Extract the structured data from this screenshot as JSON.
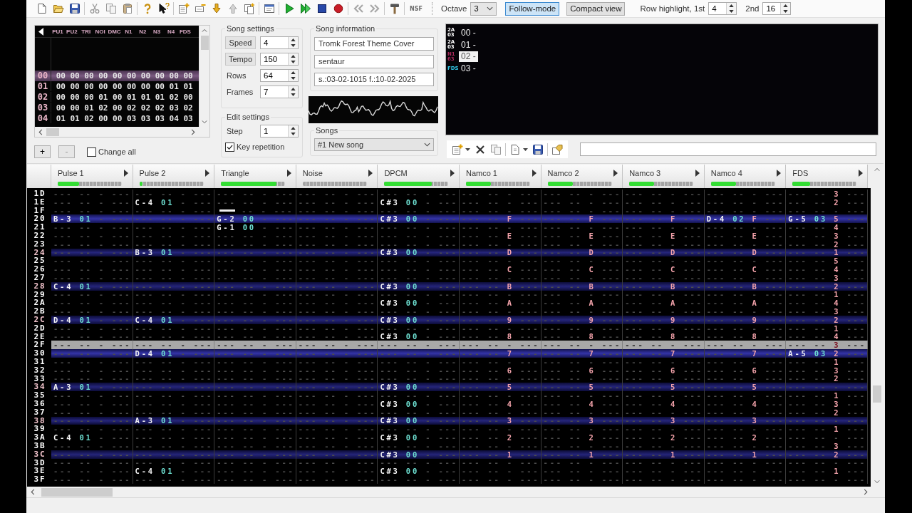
{
  "toolbar": {
    "export_label": "NSF",
    "octave": {
      "label": "Octave",
      "value": "3"
    },
    "follow_mode": {
      "label": "Follow-mode",
      "on": true
    },
    "compact_view": {
      "label": "Compact view",
      "on": false
    },
    "highlight_1st": {
      "label": "Row highlight, 1st",
      "value": "4"
    },
    "highlight_2nd": {
      "label": "2nd",
      "value": "16"
    }
  },
  "frames": {
    "columns": [
      "PU1",
      "PU2",
      "TRI",
      "NOI",
      "DMC",
      "N1",
      "N2",
      "N3",
      "N4",
      "FDS"
    ],
    "rows": [
      {
        "label": "00",
        "selected": true,
        "patterns": [
          "00",
          "00",
          "00",
          "00",
          "00",
          "00",
          "00",
          "00",
          "00",
          "00"
        ]
      },
      {
        "label": "01",
        "selected": false,
        "patterns": [
          "00",
          "00",
          "00",
          "00",
          "00",
          "00",
          "00",
          "00",
          "01",
          "01"
        ]
      },
      {
        "label": "02",
        "selected": false,
        "patterns": [
          "00",
          "00",
          "00",
          "01",
          "00",
          "01",
          "01",
          "01",
          "02",
          "00"
        ]
      },
      {
        "label": "03",
        "selected": false,
        "patterns": [
          "00",
          "00",
          "01",
          "02",
          "00",
          "02",
          "02",
          "02",
          "03",
          "02"
        ]
      },
      {
        "label": "04",
        "selected": false,
        "patterns": [
          "01",
          "01",
          "02",
          "00",
          "00",
          "03",
          "03",
          "03",
          "04",
          "03"
        ]
      }
    ]
  },
  "frame_controls": {
    "add": "+",
    "remove": "-",
    "change_all": {
      "label": "Change all",
      "checked": false
    }
  },
  "song_settings": {
    "title": "Song settings",
    "fields": [
      {
        "label": "Speed",
        "kind": "button",
        "value": "4"
      },
      {
        "label": "Tempo",
        "kind": "button",
        "value": "150"
      },
      {
        "label": "Rows",
        "kind": "label",
        "value": "64"
      },
      {
        "label": "Frames",
        "kind": "label",
        "value": "7"
      }
    ]
  },
  "edit_settings": {
    "title": "Edit settings",
    "step": {
      "label": "Step",
      "value": "1"
    },
    "key_repetition": {
      "label": "Key repetition",
      "checked": true
    }
  },
  "song_information": {
    "title": "Song information",
    "fields": [
      "Tromk Forest Theme Cover",
      "sentaur",
      "s.:03-02-1015 f.:10-02-2025"
    ]
  },
  "songs": {
    "title": "Songs",
    "value": "#1 New song"
  },
  "instruments": {
    "items": [
      {
        "chip": [
          "2A",
          "03"
        ],
        "color": "#ffffff",
        "label": "00 -",
        "selected": false
      },
      {
        "chip": [
          "2A",
          "03"
        ],
        "color": "#ffffff",
        "label": "01 -",
        "selected": false
      },
      {
        "chip": [
          "N1",
          "63"
        ],
        "color": "#a8285a",
        "label": "02 -",
        "selected": true
      },
      {
        "chip": [
          "FDS"
        ],
        "color": "#30c8e8",
        "label": "03 -",
        "selected": false
      }
    ]
  },
  "channels": [
    {
      "name": "Pulse 1",
      "level": 0.33
    },
    {
      "name": "Pulse 2",
      "level": 0.05
    },
    {
      "name": "Triangle",
      "level": 0.86
    },
    {
      "name": "Noise"
    },
    {
      "name": "DPCM",
      "level": 0.74
    },
    {
      "name": "Namco 1",
      "level": 0.39
    },
    {
      "name": "Namco 2",
      "level": 0.39
    },
    {
      "name": "Namco 3",
      "level": 0.39
    },
    {
      "name": "Namco 4",
      "level": 0.39
    },
    {
      "name": "FDS",
      "level": 0.27
    }
  ],
  "pattern": {
    "rows": [
      {
        "label": "1D",
        "kind": "normal",
        "cells": [
          "--- -- - ---",
          "--- -- - ---",
          "--- -- - ---",
          "--- -- - ---",
          "--- -- - ---",
          "--- -- - ---",
          "--- -- - ---",
          "--- -- - ---",
          "--- -- - ---",
          "--- -- 3 ---"
        ]
      },
      {
        "label": "1E",
        "kind": "normal",
        "cells": [
          "--- -- - ---",
          "C-4 01 - ---",
          "--- -- - ---",
          "--- -- - ---",
          "C#3 00 - ---",
          "--- -- - ---",
          "--- -- - ---",
          "--- -- - ---",
          "--- -- - ---",
          "--- -- 2 ---"
        ]
      },
      {
        "label": "1F",
        "kind": "normal",
        "cells": [
          "--- -- - ---",
          "--- -- - ---",
          {
            "kind": "halt",
            "rest": "-- - ---"
          },
          "--- -- - ---",
          "--- -- - ---",
          "--- -- - ---",
          "--- -- - ---",
          "--- -- - ---",
          "--- -- - ---",
          "--- -- - ---"
        ]
      },
      {
        "label": "20",
        "kind": "measure",
        "cells": [
          "B-3 01 - ---",
          "--- -- - ---",
          "G-2 00 - ---",
          "--- -- - ---",
          "C#3 00 - ---",
          "--- -- F ---",
          "--- -- F ---",
          "--- -- F ---",
          "D-4 02 F ---",
          "G-5 03 5 ---"
        ]
      },
      {
        "label": "21",
        "kind": "normal",
        "cells": [
          "--- -- - ---",
          "--- -- - ---",
          "G-1 00 - ---",
          "--- -- - ---",
          "--- -- - ---",
          "--- -- - ---",
          "--- -- - ---",
          "--- -- - ---",
          "--- -- - ---",
          "--- -- 4 ---"
        ]
      },
      {
        "label": "22",
        "kind": "normal",
        "cells": [
          "--- -- - ---",
          "--- -- - ---",
          "--- -- - ---",
          "--- -- - ---",
          "--- -- - ---",
          "--- -- E ---",
          "--- -- E ---",
          "--- -- E ---",
          "--- -- E ---",
          "--- -- 3 ---"
        ]
      },
      {
        "label": "23",
        "kind": "normal",
        "cells": [
          "--- -- - ---",
          "--- -- - ---",
          "--- -- - ---",
          "--- -- - ---",
          "--- -- - ---",
          "--- -- - ---",
          "--- -- - ---",
          "--- -- - ---",
          "--- -- - ---",
          "--- -- 2 ---"
        ]
      },
      {
        "label": "24",
        "kind": "beat",
        "cells": [
          "--- -- - ---",
          "B-3 01 - ---",
          "--- -- - ---",
          "--- -- - ---",
          "C#3 00 - ---",
          "--- -- D ---",
          "--- -- D ---",
          "--- -- D ---",
          "--- -- D ---",
          "--- -- 1 ---"
        ]
      },
      {
        "label": "25",
        "kind": "normal",
        "cells": [
          "--- -- - ---",
          "--- -- - ---",
          "--- -- - ---",
          "--- -- - ---",
          "--- -- - ---",
          "--- -- - ---",
          "--- -- - ---",
          "--- -- - ---",
          "--- -- - ---",
          "--- -- 5 ---"
        ]
      },
      {
        "label": "26",
        "kind": "normal",
        "cells": [
          "--- -- - ---",
          "--- -- - ---",
          "--- -- - ---",
          "--- -- - ---",
          "--- -- - ---",
          "--- -- C ---",
          "--- -- C ---",
          "--- -- C ---",
          "--- -- C ---",
          "--- -- 4 ---"
        ]
      },
      {
        "label": "27",
        "kind": "normal",
        "cells": [
          "--- -- - ---",
          "--- -- - ---",
          "--- -- - ---",
          "--- -- - ---",
          "--- -- - ---",
          "--- -- - ---",
          "--- -- - ---",
          "--- -- - ---",
          "--- -- - ---",
          "--- -- 3 ---"
        ]
      },
      {
        "label": "28",
        "kind": "beat",
        "cells": [
          "C-4 01 - ---",
          "--- -- - ---",
          "--- -- - ---",
          "--- -- - ---",
          "C#3 00 - ---",
          "--- -- B ---",
          "--- -- B ---",
          "--- -- B ---",
          "--- -- B ---",
          "--- -- 2 ---"
        ]
      },
      {
        "label": "29",
        "kind": "normal",
        "cells": [
          "--- -- - ---",
          "--- -- - ---",
          "--- -- - ---",
          "--- -- - ---",
          "--- -- - ---",
          "--- -- - ---",
          "--- -- - ---",
          "--- -- - ---",
          "--- -- - ---",
          "--- -- 1 ---"
        ]
      },
      {
        "label": "2A",
        "kind": "normal",
        "cells": [
          "--- -- - ---",
          "--- -- - ---",
          "--- -- - ---",
          "--- -- - ---",
          "C#3 00 - ---",
          "--- -- A ---",
          "--- -- A ---",
          "--- -- A ---",
          "--- -- A ---",
          "--- -- 4 ---"
        ]
      },
      {
        "label": "2B",
        "kind": "normal",
        "cells": [
          "--- -- - ---",
          "--- -- - ---",
          "--- -- - ---",
          "--- -- - ---",
          "--- -- - ---",
          "--- -- - ---",
          "--- -- - ---",
          "--- -- - ---",
          "--- -- - ---",
          "--- -- 3 ---"
        ]
      },
      {
        "label": "2C",
        "kind": "beat",
        "cells": [
          "D-4 01 - ---",
          "C-4 01 - ---",
          "--- -- - ---",
          "--- -- - ---",
          "C#3 00 - ---",
          "--- -- 9 ---",
          "--- -- 9 ---",
          "--- -- 9 ---",
          "--- -- 9 ---",
          "--- -- 2 ---"
        ]
      },
      {
        "label": "2D",
        "kind": "normal",
        "cells": [
          "--- -- - ---",
          "--- -- - ---",
          "--- -- - ---",
          "--- -- - ---",
          "--- -- - ---",
          "--- -- - ---",
          "--- -- - ---",
          "--- -- - ---",
          "--- -- - ---",
          "--- -- 1 ---"
        ]
      },
      {
        "label": "2E",
        "kind": "normal",
        "cells": [
          "--- -- - ---",
          "--- -- - ---",
          "--- -- - ---",
          "--- -- - ---",
          "C#3 00 - ---",
          "--- -- 8 ---",
          "--- -- 8 ---",
          "--- -- 8 ---",
          "--- -- 8 ---",
          "--- -- 4 ---"
        ]
      },
      {
        "label": "2F",
        "kind": "cursor",
        "cells": [
          "--- -- - ---",
          "--- -- - ---",
          "--- -- - ---",
          "--- -- - ---",
          "--- -- - ---",
          "--- -- - ---",
          "--- -- - ---",
          "--- -- - ---",
          "--- -- - ---",
          "--- -- 3 ---"
        ]
      },
      {
        "label": "30",
        "kind": "measure",
        "cells": [
          "--- -- - ---",
          "D-4 01 - ---",
          "--- -- - ---",
          "--- -- - ---",
          "--- -- - ---",
          "--- -- 7 ---",
          "--- -- 7 ---",
          "--- -- 7 ---",
          "--- -- 7 ---",
          "A-5 03 2 ---"
        ]
      },
      {
        "label": "31",
        "kind": "normal",
        "cells": [
          "--- -- - ---",
          "--- -- - ---",
          "--- -- - ---",
          "--- -- - ---",
          "--- -- - ---",
          "--- -- - ---",
          "--- -- - ---",
          "--- -- - ---",
          "--- -- - ---",
          "--- -- 1 ---"
        ]
      },
      {
        "label": "32",
        "kind": "normal",
        "cells": [
          "--- -- - ---",
          "--- -- - ---",
          "--- -- - ---",
          "--- -- - ---",
          "--- -- - ---",
          "--- -- 6 ---",
          "--- -- 6 ---",
          "--- -- 6 ---",
          "--- -- 6 ---",
          "--- -- 3 ---"
        ]
      },
      {
        "label": "33",
        "kind": "normal",
        "cells": [
          "--- -- - ---",
          "--- -- - ---",
          "--- -- - ---",
          "--- -- - ---",
          "--- -- - ---",
          "--- -- - ---",
          "--- -- - ---",
          "--- -- - ---",
          "--- -- - ---",
          "--- -- 2 ---"
        ]
      },
      {
        "label": "34",
        "kind": "beat",
        "cells": [
          "A-3 01 - ---",
          "--- -- - ---",
          "--- -- - ---",
          "--- -- - ---",
          "C#3 00 - ---",
          "--- -- 5 ---",
          "--- -- 5 ---",
          "--- -- 5 ---",
          "--- -- 5 ---",
          "--- -- - ---"
        ]
      },
      {
        "label": "35",
        "kind": "normal",
        "cells": [
          "--- -- - ---",
          "--- -- - ---",
          "--- -- - ---",
          "--- -- - ---",
          "--- -- - ---",
          "--- -- - ---",
          "--- -- - ---",
          "--- -- - ---",
          "--- -- - ---",
          "--- -- 1 ---"
        ]
      },
      {
        "label": "36",
        "kind": "normal",
        "cells": [
          "--- -- - ---",
          "--- -- - ---",
          "--- -- - ---",
          "--- -- - ---",
          "C#3 00 - ---",
          "--- -- 4 ---",
          "--- -- 4 ---",
          "--- -- 4 ---",
          "--- -- 4 ---",
          "--- -- 3 ---"
        ]
      },
      {
        "label": "37",
        "kind": "normal",
        "cells": [
          "--- -- - ---",
          "--- -- - ---",
          "--- -- - ---",
          "--- -- - ---",
          "--- -- - ---",
          "--- -- - ---",
          "--- -- - ---",
          "--- -- - ---",
          "--- -- - ---",
          "--- -- 2 ---"
        ]
      },
      {
        "label": "38",
        "kind": "beat",
        "cells": [
          "--- -- - ---",
          "A-3 01 - ---",
          "--- -- - ---",
          "--- -- - ---",
          "C#3 00 - ---",
          "--- -- 3 ---",
          "--- -- 3 ---",
          "--- -- 3 ---",
          "--- -- 3 ---",
          "--- -- - ---"
        ]
      },
      {
        "label": "39",
        "kind": "normal",
        "cells": [
          "--- -- - ---",
          "--- -- - ---",
          "--- -- - ---",
          "--- -- - ---",
          "--- -- - ---",
          "--- -- - ---",
          "--- -- - ---",
          "--- -- - ---",
          "--- -- - ---",
          "--- -- 1 ---"
        ]
      },
      {
        "label": "3A",
        "kind": "normal",
        "cells": [
          "C-4 01 - ---",
          "--- -- - ---",
          "--- -- - ---",
          "--- -- - ---",
          "C#3 00 - ---",
          "--- -- 2 ---",
          "--- -- 2 ---",
          "--- -- 2 ---",
          "--- -- 2 ---",
          "--- -- - ---"
        ]
      },
      {
        "label": "3B",
        "kind": "normal",
        "cells": [
          "--- -- - ---",
          "--- -- - ---",
          "--- -- - ---",
          "--- -- - ---",
          "--- -- - ---",
          "--- -- - ---",
          "--- -- - ---",
          "--- -- - ---",
          "--- -- - ---",
          "--- -- 3 ---"
        ]
      },
      {
        "label": "3C",
        "kind": "beat",
        "cells": [
          "--- -- - ---",
          "--- -- - ---",
          "--- -- - ---",
          "--- -- - ---",
          "C#3 00 - ---",
          "--- -- 1 ---",
          "--- -- 1 ---",
          "--- -- 1 ---",
          "--- -- 1 ---",
          "--- -- 2 ---"
        ]
      },
      {
        "label": "3D",
        "kind": "normal",
        "cells": [
          "--- -- - ---",
          "--- -- - ---",
          "--- -- - ---",
          "--- -- - ---",
          "--- -- - ---",
          "--- -- - ---",
          "--- -- - ---",
          "--- -- - ---",
          "--- -- - ---",
          "--- -- - ---"
        ]
      },
      {
        "label": "3E",
        "kind": "normal",
        "cells": [
          "--- -- - ---",
          "C-4 01 - ---",
          "--- -- - ---",
          "--- -- - ---",
          "C#3 00 - ---",
          "--- -- - ---",
          "--- -- - ---",
          "--- -- - ---",
          "--- -- - ---",
          "--- -- 1 ---"
        ]
      },
      {
        "label": "3F",
        "kind": "normal",
        "cells": [
          "--- -- - ---",
          "--- -- - ---",
          "--- -- - ---",
          "--- -- - ---",
          "--- -- - ---",
          "--- -- - ---",
          "--- -- - ---",
          "--- -- - ---",
          "--- -- - ---",
          "--- -- - ---"
        ]
      }
    ]
  }
}
